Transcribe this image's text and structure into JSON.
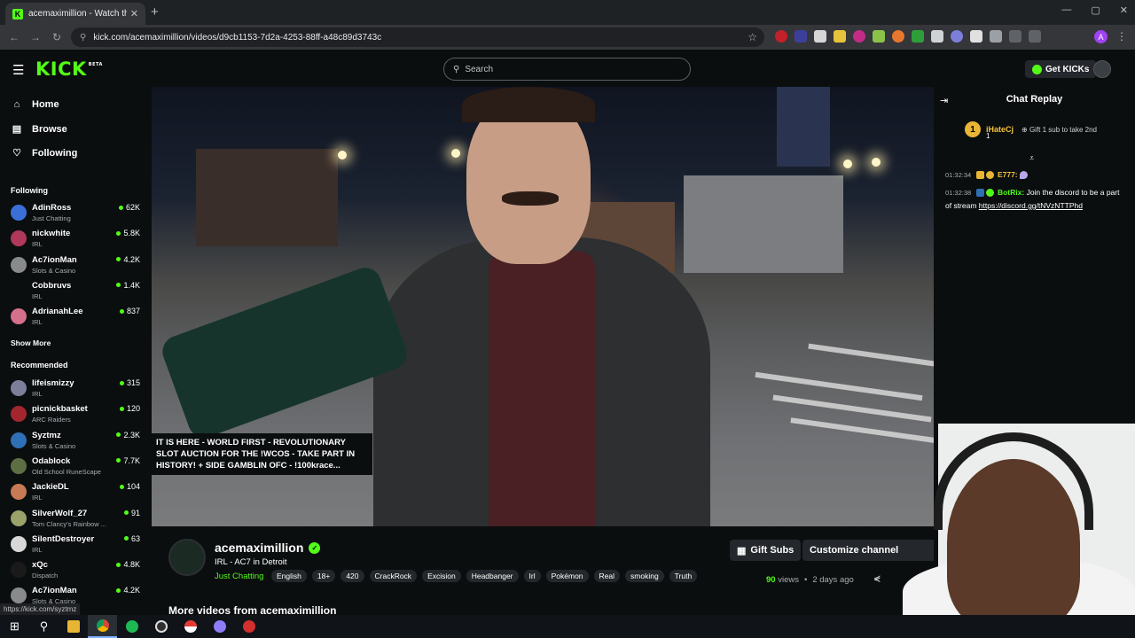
{
  "browser": {
    "tab_title": "acemaximillion - Watch the",
    "tab_favicon": "K",
    "new_tab": "+",
    "tab_close": "✕",
    "url": "kick.com/acemaximillion/videos/d9cb1153-7d2a-4253-88ff-a48c89d3743c",
    "status_url": "https://kick.com/syztmz",
    "profile_initial": "A",
    "window_controls": [
      "—",
      "▢",
      "✕"
    ]
  },
  "header": {
    "logo": "KICK",
    "logo_badge": "BETA",
    "search_placeholder": "Search",
    "get_kicks": "Get KICKs"
  },
  "sidebar": {
    "nav": [
      {
        "label": "Home",
        "icon": "home-icon"
      },
      {
        "label": "Browse",
        "icon": "browse-icon"
      },
      {
        "label": "Following",
        "icon": "heart-icon"
      }
    ],
    "following_title": "Following",
    "following": [
      {
        "name": "AdinRoss",
        "category": "Just Chatting",
        "viewers": "62K",
        "color": "#3a6fd8"
      },
      {
        "name": "nickwhite",
        "category": "IRL",
        "viewers": "5.8K",
        "color": "#b0385a"
      },
      {
        "name": "Ac7ionMan",
        "category": "Slots & Casino",
        "viewers": "4.2K",
        "color": "#888a8c"
      },
      {
        "name": "Cobbruvs",
        "category": "IRL",
        "viewers": "1.4K",
        "color": "#0b0e0f"
      },
      {
        "name": "AdrianahLee",
        "category": "IRL",
        "viewers": "837",
        "color": "#d4708c"
      }
    ],
    "show_more": "Show More",
    "recommended_title": "Recommended",
    "recommended": [
      {
        "name": "lifeismizzy",
        "category": "IRL",
        "viewers": "315",
        "color": "#7d7f9a"
      },
      {
        "name": "picnickbasket",
        "category": "ARC Raiders",
        "viewers": "120",
        "color": "#a3262e"
      },
      {
        "name": "Syztmz",
        "category": "Slots & Casino",
        "viewers": "2.3K",
        "color": "#2f6fb5"
      },
      {
        "name": "Odablock",
        "category": "Old School RuneScape",
        "viewers": "7.7K",
        "color": "#5d6f42"
      },
      {
        "name": "JackieDL",
        "category": "IRL",
        "viewers": "104",
        "color": "#c77b54"
      },
      {
        "name": "SilverWolf_27",
        "category": "Tom Clancy's Rainbow ...",
        "viewers": "91",
        "color": "#9aa26a"
      },
      {
        "name": "SilentDestroyer",
        "category": "IRL",
        "viewers": "63",
        "color": "#d8d8d8"
      },
      {
        "name": "xQc",
        "category": "Dispatch",
        "viewers": "4.8K",
        "color": "#1a1a1a"
      },
      {
        "name": "Ac7ionMan",
        "category": "Slots & Casino",
        "viewers": "4.2K",
        "color": "#888a8c"
      }
    ]
  },
  "tooltip": "IT IS HERE - WORLD FIRST - REVOLUTIONARY SLOT AUCTION FOR THE !WCOS - TAKE PART IN HISTORY! + SIDE GAMBLIN OFC - !100krace...",
  "chat": {
    "title": "Chat Replay",
    "pinned": {
      "rank": "1",
      "user": "iHateCj",
      "gift_count": "1",
      "gift_text": "Gift 1 sub to take 2nd"
    },
    "messages": [
      {
        "time": "01:32:34",
        "user": "E777:",
        "text": "",
        "user_color": "#f3c338"
      },
      {
        "time": "01:32:38",
        "user": "BotRix:",
        "text": "Join the discord to be a part of stream ",
        "link": "https://discord.gg/tNVzNTTPhd",
        "user_color": "#53fc18"
      }
    ]
  },
  "stream": {
    "channel": "acemaximillion",
    "title": "IRL - AC7 in Detroit",
    "category": "Just Chatting",
    "tags": [
      "English",
      "18+",
      "420",
      "CrackRock",
      "Excision",
      "Headbanger",
      "Irl",
      "Pokémon",
      "Real",
      "smoking",
      "Truth"
    ],
    "gift_subs": "Gift Subs",
    "customize": "Customize channel",
    "views_count": "90",
    "views_label": "views",
    "separator": "•",
    "age": "2 days ago",
    "more_videos": "More videos from acemaximillion"
  },
  "taskbar": [
    "windows-icon",
    "search-icon",
    "file-explorer-icon",
    "chrome-icon",
    "spotify-icon",
    "obs-icon",
    "pokeball-icon",
    "discord-icon",
    "record-icon"
  ]
}
